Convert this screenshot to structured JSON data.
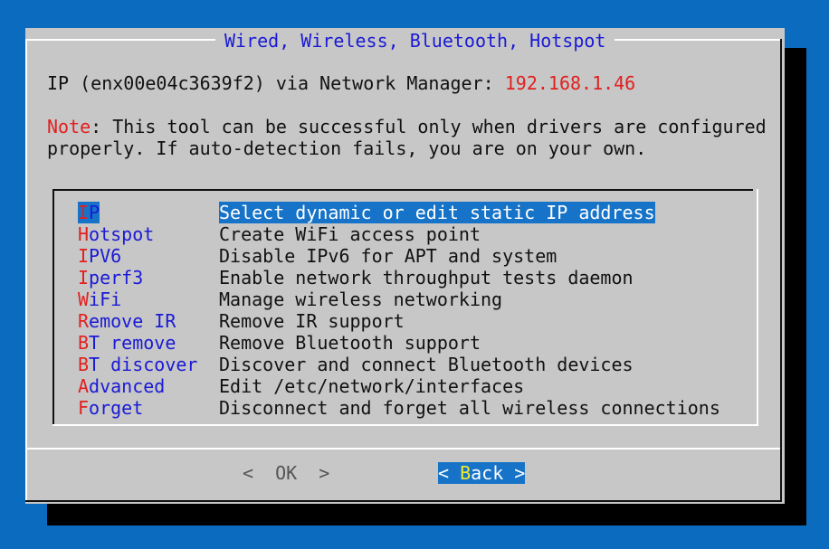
{
  "dialog": {
    "title": "Wired, Wireless, Bluetooth, Hotspot",
    "ip_prefix": "IP (enx00e04c3639f2) via Network Manager: ",
    "ip_address": "192.168.1.46",
    "note_label": "Note",
    "note_line1": ": This tool can be successful only when drivers are configured",
    "note_line2": "properly. If auto-detection fails, you are on your own."
  },
  "menu": {
    "selected_index": 0,
    "items": [
      {
        "tag_first": "I",
        "tag_rest": "P",
        "desc": "Select dynamic or edit static IP address"
      },
      {
        "tag_first": "H",
        "tag_rest": "otspot",
        "desc": "Create WiFi access point"
      },
      {
        "tag_first": "I",
        "tag_rest": "PV6",
        "desc": "Disable IPv6 for APT and system"
      },
      {
        "tag_first": "I",
        "tag_rest": "perf3",
        "desc": "Enable network throughput tests daemon"
      },
      {
        "tag_first": "W",
        "tag_rest": "iFi",
        "desc": "Manage wireless networking"
      },
      {
        "tag_first": "R",
        "tag_rest": "emove IR",
        "desc": "Remove IR support"
      },
      {
        "tag_first": "B",
        "tag_rest": "T remove",
        "desc": "Remove Bluetooth support"
      },
      {
        "tag_first": "B",
        "tag_rest": "T discover",
        "desc": "Discover and connect Bluetooth devices"
      },
      {
        "tag_first": "A",
        "tag_rest": "dvanced",
        "desc": "Edit /etc/network/interfaces"
      },
      {
        "tag_first": "F",
        "tag_rest": "orget",
        "desc": "Disconnect and forget all wireless connections"
      }
    ]
  },
  "buttons": {
    "ok_label": "<  OK  >",
    "back_left": "< ",
    "back_hot": "B",
    "back_rest": "ack >"
  },
  "colors": {
    "background": "#0b6cbf",
    "dialog": "#c7c7c7",
    "highlight": "#1673c8",
    "hotkey": "#e12020",
    "tag": "#1a1ad6"
  }
}
